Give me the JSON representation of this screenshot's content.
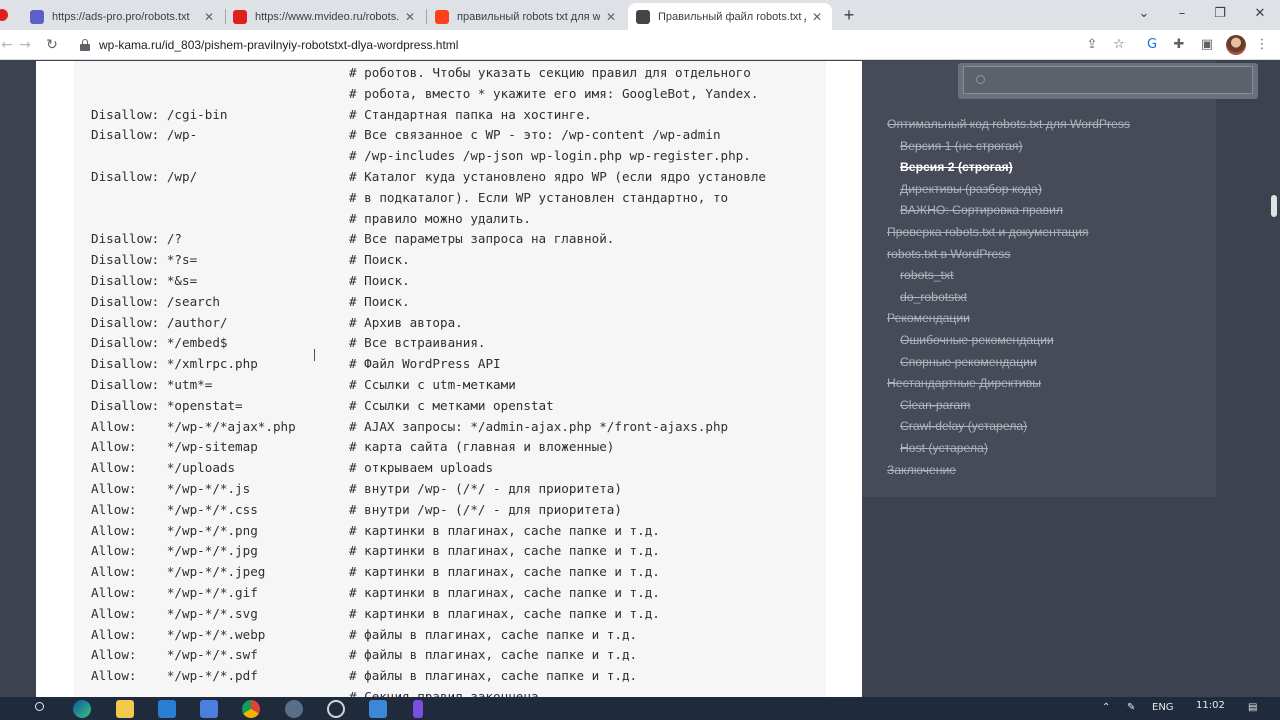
{
  "browser": {
    "tabs": [
      {
        "title": "https://ads-pro.pro/robots.txt",
        "icon": "ads-pro-favicon",
        "color": "#5b5fc7"
      },
      {
        "title": "https://www.mvideo.ru/robots.txt",
        "icon": "mvideo-favicon",
        "color": "#e0201b"
      },
      {
        "title": "правильный robots txt для wordpress",
        "icon": "yandex-favicon",
        "color": "#fc3f1d"
      },
      {
        "title": "Правильный файл robots.txt для WordPress",
        "icon": "wp-kama-favicon",
        "color": "#444444",
        "active": true
      }
    ],
    "new_tab": "+",
    "url": "wp-kama.ru/id_803/pishem-pravilnyiy-robotstxt-dlya-wordpress.html"
  },
  "code_lines": [
    {
      "directive": "",
      "comment": "# роботов. Чтобы указать секцию правил для отдельного"
    },
    {
      "directive": "",
      "comment": "# робота, вместо * укажите его имя: GoogleBot, Yandex."
    },
    {
      "directive": "Disallow: /cgi-bin",
      "comment": "# Стандартная папка на хостинге."
    },
    {
      "directive": "Disallow: /wp-",
      "comment": "# Все связанное с WP - это: /wp-content /wp-admin"
    },
    {
      "directive": "",
      "comment": "# /wp-includes /wp-json wp-login.php wp-register.php."
    },
    {
      "directive": "Disallow: /wp/",
      "comment": "# Каталог куда установлено ядро WP (если ядро установле"
    },
    {
      "directive": "",
      "comment": "# в подкаталог). Если WP установлен стандартно, то"
    },
    {
      "directive": "",
      "comment": "# правило можно удалить."
    },
    {
      "directive": "Disallow: /?",
      "comment": "# Все параметры запроса на главной."
    },
    {
      "directive": "Disallow: *?s=",
      "comment": "# Поиск."
    },
    {
      "directive": "Disallow: *&s=",
      "comment": "# Поиск."
    },
    {
      "directive": "Disallow: /search",
      "comment": "# Поиск."
    },
    {
      "directive": "Disallow: /author/",
      "comment": "# Архив автора."
    },
    {
      "directive": "Disallow: */embed$",
      "comment": "# Все встраивания."
    },
    {
      "directive": "Disallow: */xmlrpc.php",
      "comment": "# Файл WordPress API"
    },
    {
      "directive": "Disallow: *utm*=",
      "comment": "# Ссылки с utm-метками"
    },
    {
      "directive": "Disallow: *openstat=",
      "comment": "# Ссылки с метками openstat"
    },
    {
      "directive": "Allow:    */wp-*/*ajax*.php",
      "comment": "# AJAX запросы: */admin-ajax.php */front-ajaxs.php"
    },
    {
      "directive": "Allow:    */wp-sitemap",
      "comment": "# карта сайта (главная и вложенные)"
    },
    {
      "directive": "Allow:    */uploads",
      "comment": "# открываем uploads"
    },
    {
      "directive": "Allow:    */wp-*/*.js",
      "comment": "# внутри /wp- (/*/ - для приоритета)"
    },
    {
      "directive": "Allow:    */wp-*/*.css",
      "comment": "# внутри /wp- (/*/ - для приоритета)"
    },
    {
      "directive": "Allow:    */wp-*/*.png",
      "comment": "# картинки в плагинах, cache папке и т.д."
    },
    {
      "directive": "Allow:    */wp-*/*.jpg",
      "comment": "# картинки в плагинах, cache папке и т.д."
    },
    {
      "directive": "Allow:    */wp-*/*.jpeg",
      "comment": "# картинки в плагинах, cache папке и т.д."
    },
    {
      "directive": "Allow:    */wp-*/*.gif",
      "comment": "# картинки в плагинах, cache папке и т.д."
    },
    {
      "directive": "Allow:    */wp-*/*.svg",
      "comment": "# картинки в плагинах, cache папке и т.д."
    },
    {
      "directive": "Allow:    */wp-*/*.webp",
      "comment": "# файлы в плагинах, cache папке и т.д."
    },
    {
      "directive": "Allow:    */wp-*/*.swf",
      "comment": "# файлы в плагинах, cache папке и т.д."
    },
    {
      "directive": "Allow:    */wp-*/*.pdf",
      "comment": "# файлы в плагинах, cache папке и т.д."
    },
    {
      "directive": "",
      "comment": "# Секция правил закончена"
    }
  ],
  "toc": [
    {
      "label": "Оптимальный код robots.txt для WordPress",
      "level": 0
    },
    {
      "label": "Версия 1 (не строгая)",
      "level": 1
    },
    {
      "label": "Версия 2 (строгая)",
      "level": 1,
      "current": true
    },
    {
      "label": "Директивы (разбор кода)",
      "level": 1
    },
    {
      "label": "ВАЖНО: Сортировка правил",
      "level": 1
    },
    {
      "label": "Проверка robots.txt и документация",
      "level": 0
    },
    {
      "label": "robots.txt в WordPress",
      "level": 0
    },
    {
      "label": "robots_txt",
      "level": 1
    },
    {
      "label": "do_robotstxt",
      "level": 1
    },
    {
      "label": "Рекомендации",
      "level": 0
    },
    {
      "label": "Ошибочные рекомендации",
      "level": 1
    },
    {
      "label": "Спорные рекомендации",
      "level": 1
    },
    {
      "label": "Нестандартные Директивы",
      "level": 0
    },
    {
      "label": "Clean-param",
      "level": 1
    },
    {
      "label": "Crawl-delay (устарела)",
      "level": 1
    },
    {
      "label": "Host (устарела)",
      "level": 1
    },
    {
      "label": "Заключение",
      "level": 0
    }
  ],
  "taskbar": {
    "lang": "ENG",
    "time": "11:02"
  }
}
